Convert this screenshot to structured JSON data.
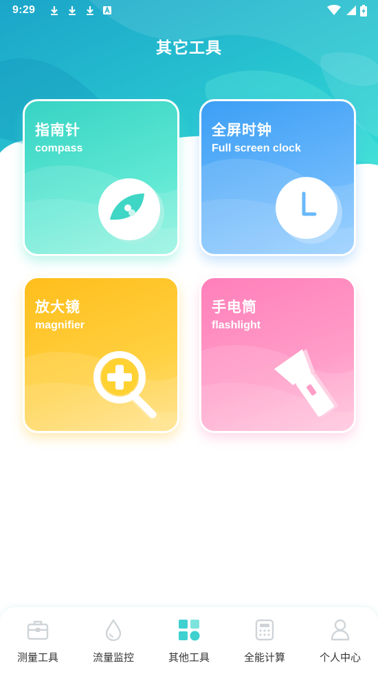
{
  "status_bar": {
    "time": "9:29",
    "left_icons": [
      "download-icon",
      "download-icon",
      "download-icon",
      "a-badge-icon"
    ],
    "right_icons": [
      "wifi-icon",
      "signal-icon",
      "battery-charging-icon"
    ]
  },
  "header": {
    "title": "其它工具"
  },
  "tools": [
    {
      "title": "指南针",
      "subtitle": "compass",
      "icon": "compass-icon",
      "color": "#3fd6c6"
    },
    {
      "title": "全屏时钟",
      "subtitle": "Full screen clock",
      "icon": "clock-icon",
      "color": "#4aa8f8"
    },
    {
      "title": "放大镜",
      "subtitle": "magnifier",
      "icon": "magnifier-icon",
      "color": "#ffc21f"
    },
    {
      "title": "手电筒",
      "subtitle": "flashlight",
      "icon": "flashlight-icon",
      "color": "#ff85bd"
    }
  ],
  "tab_bar": {
    "items": [
      {
        "label": "测量工具",
        "icon": "toolbox-icon",
        "active": false
      },
      {
        "label": "流量监控",
        "icon": "droplet-icon",
        "active": false
      },
      {
        "label": "其他工具",
        "icon": "grid-tiles-icon",
        "active": true
      },
      {
        "label": "全能计算",
        "icon": "calculator-icon",
        "active": false
      },
      {
        "label": "个人中心",
        "icon": "person-icon",
        "active": false
      }
    ],
    "active_color": "#3fd0d0",
    "inactive_color": "#cfd4d8"
  }
}
